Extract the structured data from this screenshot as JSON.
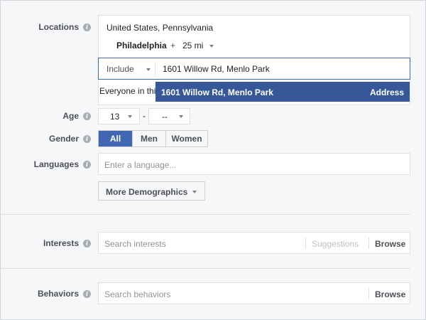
{
  "locations": {
    "label": "Locations",
    "country_region": "United States, Pennsylvania",
    "city": "Philadelphia",
    "plus": "+",
    "radius": "25 mi",
    "include_label": "Include",
    "search_value": "1601 Willow Rd, Menlo Park",
    "everyone_text": "Everyone in thi",
    "suggestion": {
      "text": "1601 Willow Rd, Menlo Park",
      "type": "Address"
    }
  },
  "age": {
    "label": "Age",
    "min": "13",
    "separator": "-",
    "max": "--"
  },
  "gender": {
    "label": "Gender",
    "options": [
      "All",
      "Men",
      "Women"
    ],
    "selected": "All"
  },
  "languages": {
    "label": "Languages",
    "placeholder": "Enter a language..."
  },
  "more_demographics": {
    "label": "More Demographics"
  },
  "interests": {
    "label": "Interests",
    "placeholder": "Search interests",
    "suggestions": "Suggestions",
    "browse": "Browse"
  },
  "behaviors": {
    "label": "Behaviors",
    "placeholder": "Search behaviors",
    "browse": "Browse"
  },
  "colors": {
    "accent": "#4267b2",
    "highlight": "#365899",
    "label": "#4b4f56"
  }
}
